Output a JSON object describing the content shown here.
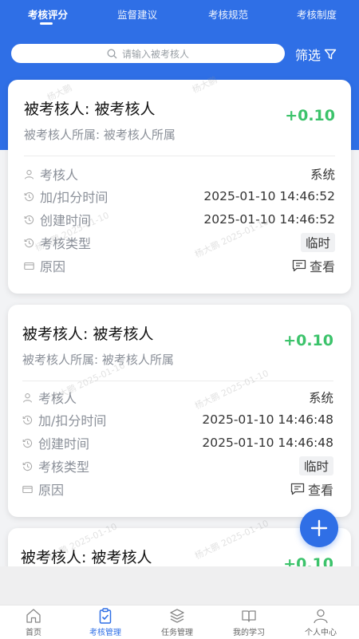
{
  "tabs": [
    {
      "label": "考核评分",
      "active": true
    },
    {
      "label": "监督建议",
      "active": false
    },
    {
      "label": "考核规范",
      "active": false
    },
    {
      "label": "考核制度",
      "active": false
    }
  ],
  "search": {
    "placeholder": "请输入被考核人"
  },
  "filter": {
    "label": "筛选"
  },
  "labels": {
    "assessor": "考核人",
    "time": "加/扣分时间",
    "created": "创建时间",
    "type": "考核类型",
    "reason": "原因",
    "view": "查看"
  },
  "cards": [
    {
      "title": "被考核人: 被考核人",
      "score": "+0.10",
      "sub": "被考核人所属: 被考核人所属",
      "assessor": "系统",
      "time": "2025-01-10 14:46:52",
      "created": "2025-01-10 14:46:52",
      "type": "临时"
    },
    {
      "title": "被考核人: 被考核人",
      "score": "+0.10",
      "sub": "被考核人所属: 被考核人所属",
      "assessor": "系统",
      "time": "2025-01-10 14:46:48",
      "created": "2025-01-10 14:46:48",
      "type": "临时"
    },
    {
      "title": "被考核人: 被考核人",
      "score": "+0.10"
    }
  ],
  "watermark": [
    "杨大鹏",
    "杨大鹏 2025-01-10"
  ],
  "tabbar": [
    {
      "label": "首页",
      "icon": "home-icon",
      "active": false
    },
    {
      "label": "考核管理",
      "icon": "clipboard-check-icon",
      "active": true
    },
    {
      "label": "任务管理",
      "icon": "layers-icon",
      "active": false
    },
    {
      "label": "我的学习",
      "icon": "book-icon",
      "active": false
    },
    {
      "label": "个人中心",
      "icon": "user-icon",
      "active": false
    }
  ],
  "colors": {
    "primary": "#2f6fe6",
    "score": "#3cc36b"
  }
}
